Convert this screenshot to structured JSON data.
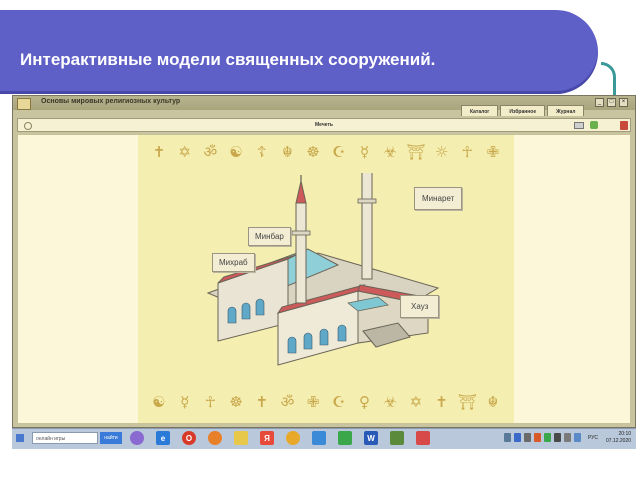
{
  "slide": {
    "title": "Интерактивные модели священных сооружений."
  },
  "app": {
    "window_title": "Основы мировых религиозных культур",
    "tabs": [
      "Каталог",
      "Избранное",
      "Журнал"
    ],
    "toolbar_title": "Мечеть",
    "colors": {
      "accent": "#5f5fc8",
      "panel": "#f4eeb0",
      "symbol": "#c9a84c"
    }
  },
  "model": {
    "callouts": {
      "minaret": "Минарет",
      "minbar": "Минбар",
      "mihrab": "Михраб",
      "hauz": "Хауз"
    }
  },
  "symbols_top": [
    "✝",
    "✡",
    "ॐ",
    "☯",
    "☦",
    "☬",
    "☸",
    "☪",
    "☿",
    "☣",
    "⛩",
    "☼",
    "☥",
    "✙"
  ],
  "symbols_bottom": [
    "☯",
    "☿",
    "☥",
    "☸",
    "✝",
    "ॐ",
    "✙",
    "☪",
    "♀",
    "☣",
    "✡",
    "✝",
    "⛩",
    "☬"
  ],
  "taskbar": {
    "search_placeholder": "онлайн игры",
    "search_button": "найти",
    "icons": [
      "start-icon",
      "browser-ie-icon",
      "opera-icon",
      "firefox-icon",
      "explorer-icon",
      "yandex-icon",
      "avast-icon",
      "media-icon",
      "table-icon",
      "word-icon",
      "image-icon",
      "pdf-icon"
    ],
    "lang": "РУС",
    "time": "20:10",
    "date": "07.12.2020"
  }
}
